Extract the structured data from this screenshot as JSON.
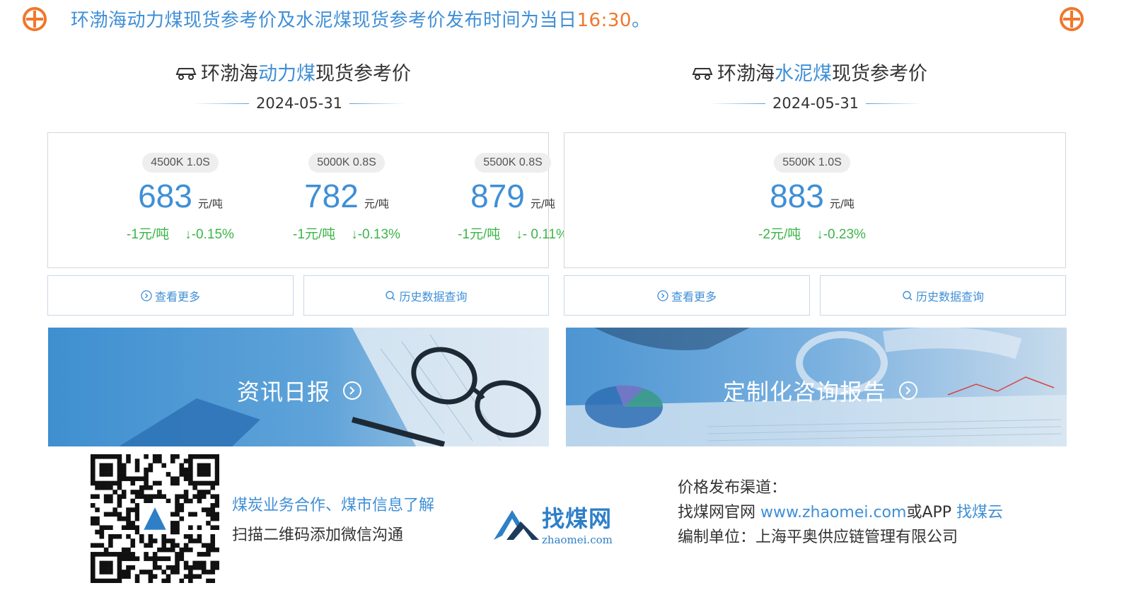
{
  "notice": {
    "text": "环渤海动力煤现货参考价及水泥煤现货参考价发布时间为当日",
    "time": "16:30",
    "suffix": "。"
  },
  "colors": {
    "accent": "#3f8fd6",
    "orange": "#f0772b",
    "green_down": "#3bb548"
  },
  "left": {
    "title_pre": "环渤海",
    "title_hl": "动力煤",
    "title_post": "现货参考价",
    "date": "2024-05-31",
    "items": [
      {
        "spec": "4500K 1.0S",
        "price": "683",
        "unit": "元/吨",
        "change": "-1元/吨",
        "pct": "↓-0.15%"
      },
      {
        "spec": "5000K 0.8S",
        "price": "782",
        "unit": "元/吨",
        "change": "-1元/吨",
        "pct": "↓-0.13%"
      },
      {
        "spec": "5500K 0.8S",
        "price": "879",
        "unit": "元/吨",
        "change": "-1元/吨",
        "pct": "↓- 0.11%"
      }
    ],
    "more_label": "查看更多",
    "history_label": "历史数据查询",
    "banner_label": "资讯日报"
  },
  "right": {
    "title_pre": "环渤海",
    "title_hl": "水泥煤",
    "title_post": "现货参考价",
    "date": "2024-05-31",
    "items": [
      {
        "spec": "5500K 1.0S",
        "price": "883",
        "unit": "元/吨",
        "change": "-2元/吨",
        "pct": "↓-0.23%"
      }
    ],
    "more_label": "查看更多",
    "history_label": "历史数据查询",
    "banner_label": "定制化咨询报告"
  },
  "footer": {
    "contact_line1": "煤炭业务合作、煤市信息了解",
    "contact_line2": "扫描二维码添加微信沟通",
    "logo_cn": "找煤网",
    "logo_en": "zhaomei.com",
    "channel_title": "价格发布渠道：",
    "channel_site_pre": "找煤网官网 ",
    "channel_site_url": "www.zhaomei.com",
    "channel_app_pre": "或APP ",
    "channel_app_name": "找煤云",
    "compiler": "编制单位：上海平奥供应链管理有限公司"
  }
}
